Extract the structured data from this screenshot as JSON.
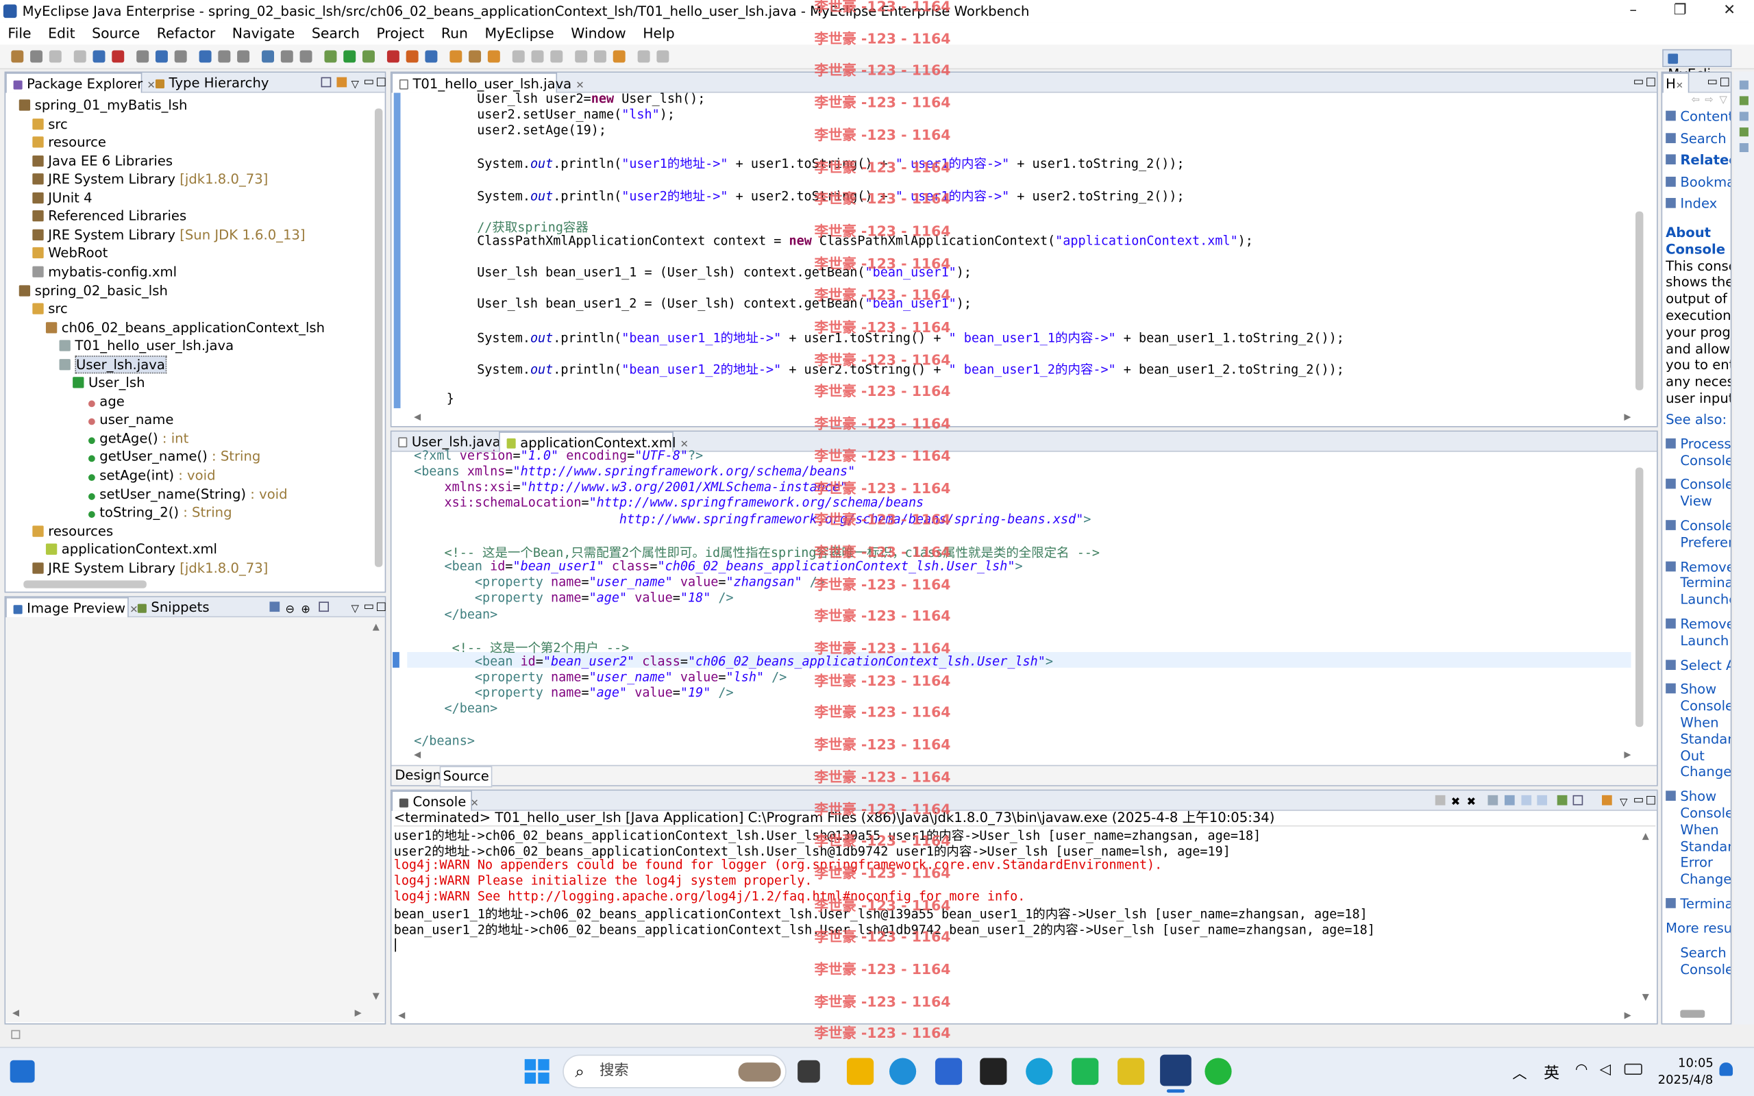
{
  "window": {
    "title": "MyEclipse Java Enterprise - spring_02_basic_lsh/src/ch06_02_beans_applicationContext_lsh/T01_hello_user_lsh.java - MyEclipse Enterprise Workbench",
    "minimize": "–",
    "maximize": "❐",
    "close": "✕"
  },
  "menu": [
    "File",
    "Edit",
    "Source",
    "Refactor",
    "Navigate",
    "Search",
    "Project",
    "Run",
    "MyEclipse",
    "Window",
    "Help"
  ],
  "perspective": "MyEcli...",
  "package_explorer": {
    "tab1": "Package Explorer",
    "tab2": "Type Hierarchy",
    "items": [
      {
        "text": "spring_01_myBatis_lsh",
        "extra": "",
        "indent": 0,
        "icon": "project"
      },
      {
        "text": "src",
        "extra": "",
        "indent": 1,
        "icon": "folder"
      },
      {
        "text": "resource",
        "extra": "",
        "indent": 1,
        "icon": "folder"
      },
      {
        "text": "Java EE 6 Libraries",
        "extra": "",
        "indent": 1,
        "icon": "lib"
      },
      {
        "text": "JRE System Library",
        "extra": " [jdk1.8.0_73]",
        "indent": 1,
        "icon": "lib"
      },
      {
        "text": "JUnit 4",
        "extra": "",
        "indent": 1,
        "icon": "lib"
      },
      {
        "text": "Referenced Libraries",
        "extra": "",
        "indent": 1,
        "icon": "lib"
      },
      {
        "text": "JRE System Library",
        "extra": " [Sun JDK 1.6.0_13]",
        "indent": 1,
        "icon": "lib"
      },
      {
        "text": "WebRoot",
        "extra": "",
        "indent": 1,
        "icon": "folder"
      },
      {
        "text": "mybatis-config.xml",
        "extra": "",
        "indent": 1,
        "icon": "file"
      },
      {
        "text": "spring_02_basic_lsh",
        "extra": "",
        "indent": 0,
        "icon": "project"
      },
      {
        "text": "src",
        "extra": "",
        "indent": 1,
        "icon": "folder"
      },
      {
        "text": "ch06_02_beans_applicationContext_lsh",
        "extra": "",
        "indent": 2,
        "icon": "package"
      },
      {
        "text": "T01_hello_user_lsh.java",
        "extra": "",
        "indent": 3,
        "icon": "java"
      },
      {
        "text": "User_lsh.java",
        "extra": "",
        "indent": 3,
        "icon": "java"
      },
      {
        "text": "User_lsh",
        "extra": "",
        "indent": 4,
        "icon": "class"
      },
      {
        "text": "age",
        "extra": "",
        "indent": 5,
        "icon": "field"
      },
      {
        "text": "user_name",
        "extra": "",
        "indent": 5,
        "icon": "field"
      },
      {
        "text": "getAge()",
        "extra": " : int",
        "indent": 5,
        "icon": "method"
      },
      {
        "text": "getUser_name()",
        "extra": " : String",
        "indent": 5,
        "icon": "method"
      },
      {
        "text": "setAge(int)",
        "extra": " : void",
        "indent": 5,
        "icon": "method"
      },
      {
        "text": "setUser_name(String)",
        "extra": " : void",
        "indent": 5,
        "icon": "method"
      },
      {
        "text": "toString_2()",
        "extra": " : String",
        "indent": 5,
        "icon": "method"
      },
      {
        "text": "resources",
        "extra": "",
        "indent": 1,
        "icon": "folder"
      },
      {
        "text": "applicationContext.xml",
        "extra": "",
        "indent": 2,
        "icon": "xml"
      },
      {
        "text": "JRE System Library",
        "extra": " [jdk1.8.0_73]",
        "indent": 1,
        "icon": "lib"
      }
    ],
    "selected_index": 14
  },
  "image_preview": {
    "tab1": "Image Preview",
    "tab2": "Snippets"
  },
  "editor1": {
    "tab": "T01_hello_user_lsh.java",
    "lines": [
      [
        [
          "",
          "        User_lsh user2="
        ],
        [
          "kw",
          "new"
        ],
        [
          "",
          " User_lsh();"
        ]
      ],
      [
        [
          "",
          "        user2.setUser_name("
        ],
        [
          "st",
          "\"lsh\""
        ],
        [
          "",
          ");"
        ]
      ],
      [
        [
          "",
          "        user2.setAge(19);"
        ]
      ],
      [],
      [
        [
          "",
          "        System."
        ],
        [
          "it",
          "out"
        ],
        [
          "",
          ".println("
        ],
        [
          "st",
          "\"user1的地址->\""
        ],
        [
          "",
          " + user1.toString() + "
        ],
        [
          "st",
          "\" user1的内容->\""
        ],
        [
          "",
          " + user1.toString_2());"
        ]
      ],
      [],
      [
        [
          "",
          "        System."
        ],
        [
          "it",
          "out"
        ],
        [
          "",
          ".println("
        ],
        [
          "st",
          "\"user2的地址->\""
        ],
        [
          "",
          " + user2.toString() + "
        ],
        [
          "st",
          "\" user1的内容->\""
        ],
        [
          "",
          " + user2.toString_2());"
        ]
      ],
      [],
      [
        [
          "cm",
          "        //获取spring容器"
        ]
      ],
      [
        [
          "",
          "        ClassPathXmlApplicationContext context = "
        ],
        [
          "kw",
          "new"
        ],
        [
          "",
          " ClassPathXmlApplicationContext("
        ],
        [
          "st",
          "\"applicationContext.xml\""
        ],
        [
          "",
          ");"
        ]
      ],
      [],
      [
        [
          "",
          "        User_lsh bean_user1_1 = (User_lsh) context.getBean("
        ],
        [
          "st",
          "\"bean_user1\""
        ],
        [
          "",
          ");"
        ]
      ],
      [],
      [
        [
          "",
          "        User_lsh bean_user1_2 = (User_lsh) context.getBean("
        ],
        [
          "st",
          "\"bean_user1\""
        ],
        [
          "",
          ");"
        ]
      ],
      [],
      [
        [
          "",
          "        System."
        ],
        [
          "it",
          "out"
        ],
        [
          "",
          ".println("
        ],
        [
          "st",
          "\"bean_user1_1的地址->\""
        ],
        [
          "",
          " + user1.toString() + "
        ],
        [
          "st",
          "\" bean_user1_1的内容->\""
        ],
        [
          "",
          " + bean_user1_1.toString_2());"
        ]
      ],
      [],
      [
        [
          "",
          "        System."
        ],
        [
          "it",
          "out"
        ],
        [
          "",
          ".println("
        ],
        [
          "st",
          "\"bean_user1_2的地址->\""
        ],
        [
          "",
          " + user2.toString() + "
        ],
        [
          "st",
          "\" bean_user1_2的内容->\""
        ],
        [
          "",
          " + bean_user1_2.toString_2());"
        ]
      ],
      [],
      [
        [
          "",
          "    }"
        ]
      ]
    ]
  },
  "editor2": {
    "tab1": "User_lsh.java",
    "tab2": "applicationContext.xml",
    "design": "Design",
    "source": "Source",
    "lines": [
      [
        [
          "xt",
          "<?xml "
        ],
        [
          "xa",
          "version"
        ],
        [
          "",
          "="
        ],
        [
          "xv",
          "\"1.0\""
        ],
        [
          "",
          " "
        ],
        [
          "xa",
          "encoding"
        ],
        [
          "",
          "="
        ],
        [
          "xv",
          "\"UTF-8\""
        ],
        [
          "xt",
          "?>"
        ]
      ],
      [
        [
          "xt",
          "<beans "
        ],
        [
          "xa",
          "xmlns"
        ],
        [
          "",
          "="
        ],
        [
          "xv",
          "\"http://www.springframework.org/schema/beans\""
        ]
      ],
      [
        [
          "",
          "    "
        ],
        [
          "xa",
          "xmlns:xsi"
        ],
        [
          "",
          "="
        ],
        [
          "xv",
          "\"http://www.w3.org/2001/XMLSchema-instance\""
        ]
      ],
      [
        [
          "",
          "    "
        ],
        [
          "xa",
          "xsi:schemaLocation"
        ],
        [
          "",
          "="
        ],
        [
          "xv",
          "\"http://www.springframework.org/schema/beans"
        ]
      ],
      [
        [
          "xv",
          "                           http://www.springframework.org/schema/beans/spring-beans.xsd\""
        ],
        [
          "xt",
          ">"
        ]
      ],
      [],
      [
        [
          "cm",
          "    <!-- 这是一个Bean,只需配置2个属性即可。id属性指在spring容器唯一标识，class属性就是类的全限定名 -->"
        ]
      ],
      [
        [
          "xt",
          "    <bean "
        ],
        [
          "xa",
          "id"
        ],
        [
          "",
          "="
        ],
        [
          "xv",
          "\"bean_user1\""
        ],
        [
          "",
          " "
        ],
        [
          "xa",
          "class"
        ],
        [
          "",
          "="
        ],
        [
          "xv",
          "\"ch06_02_beans_applicationContext_lsh.User_lsh\""
        ],
        [
          "xt",
          ">"
        ]
      ],
      [
        [
          "xt",
          "        <property "
        ],
        [
          "xa",
          "name"
        ],
        [
          "",
          "="
        ],
        [
          "xv",
          "\"user_name\""
        ],
        [
          "",
          " "
        ],
        [
          "xa",
          "value"
        ],
        [
          "",
          "="
        ],
        [
          "xv",
          "\"zhangsan\""
        ],
        [
          "xt",
          " />"
        ]
      ],
      [
        [
          "xt",
          "        <property "
        ],
        [
          "xa",
          "name"
        ],
        [
          "",
          "="
        ],
        [
          "xv",
          "\"age\""
        ],
        [
          "",
          " "
        ],
        [
          "xa",
          "value"
        ],
        [
          "",
          "="
        ],
        [
          "xv",
          "\"18\""
        ],
        [
          "xt",
          " />"
        ]
      ],
      [
        [
          "xt",
          "    </bean>"
        ]
      ],
      [],
      [
        [
          "cm",
          "     <!-- 这是一个第2个用户 -->"
        ]
      ],
      [
        [
          "xt",
          "        <bean "
        ],
        [
          "xa",
          "id"
        ],
        [
          "",
          "="
        ],
        [
          "xv",
          "\"bean_user2\""
        ],
        [
          "",
          " "
        ],
        [
          "xa",
          "class"
        ],
        [
          "",
          "="
        ],
        [
          "xv",
          "\"ch06_02_beans_applicationContext_lsh.User_lsh\""
        ],
        [
          "xt",
          ">"
        ]
      ],
      [
        [
          "xt",
          "        <property "
        ],
        [
          "xa",
          "name"
        ],
        [
          "",
          "="
        ],
        [
          "xv",
          "\"user_name\""
        ],
        [
          "",
          " "
        ],
        [
          "xa",
          "value"
        ],
        [
          "",
          "="
        ],
        [
          "xv",
          "\"lsh\""
        ],
        [
          "xt",
          " />"
        ]
      ],
      [
        [
          "xt",
          "        <property "
        ],
        [
          "xa",
          "name"
        ],
        [
          "",
          "="
        ],
        [
          "xv",
          "\"age\""
        ],
        [
          "",
          " "
        ],
        [
          "xa",
          "value"
        ],
        [
          "",
          "="
        ],
        [
          "xv",
          "\"19\""
        ],
        [
          "xt",
          " />"
        ]
      ],
      [
        [
          "xt",
          "    </bean>"
        ]
      ],
      [],
      [
        [
          "xt",
          "</beans>"
        ]
      ]
    ]
  },
  "console": {
    "tab": "Console",
    "status": "<terminated> T01_hello_user_lsh [Java Application] C:\\Program Files (x86)\\Java\\jdk1.8.0_73\\bin\\javaw.exe (2025-4-8 上午10:05:34)",
    "lines": [
      {
        "text": "user1的地址->ch06_02_beans_applicationContext_lsh.User_lsh@139a55 user1的内容->User_lsh [user_name=zhangsan, age=18]",
        "err": false
      },
      {
        "text": "user2的地址->ch06_02_beans_applicationContext_lsh.User_lsh@1db9742 user1的内容->User_lsh [user_name=lsh, age=19]",
        "err": false
      },
      {
        "text": "log4j:WARN No appenders could be found for logger (org.springframework.core.env.StandardEnvironment).",
        "err": true
      },
      {
        "text": "log4j:WARN Please initialize the log4j system properly.",
        "err": true
      },
      {
        "text": "log4j:WARN See http://logging.apache.org/log4j/1.2/faq.html#noconfig for more info.",
        "err": true
      },
      {
        "text": "bean_user1_1的地址->ch06_02_beans_applicationContext_lsh.User_lsh@139a55 bean_user1_1的内容->User_lsh [user_name=zhangsan, age=18]",
        "err": false
      },
      {
        "text": "bean_user1_2的地址->ch06_02_beans_applicationContext_lsh.User_lsh@1db9742 bean_user1_2的内容->User_lsh [user_name=zhangsan, age=18]",
        "err": false
      }
    ]
  },
  "help": {
    "tab": "H",
    "items": [
      "Content",
      "Search",
      "Relatec",
      "Bookma",
      "Index"
    ],
    "about_title": [
      "About",
      "Console"
    ],
    "about_text": [
      "This consol",
      "shows the",
      "output of t",
      "execution c",
      "your progr",
      "and allows",
      "you to ente",
      "any necess",
      "user input."
    ],
    "see_also": "See also:",
    "links": [
      [
        "Process",
        "Console"
      ],
      [
        "Console",
        "View"
      ],
      [
        "Console",
        "Preferen"
      ],
      [
        "Remove",
        "Termina",
        "Launche"
      ],
      [
        "Remove",
        "Launch"
      ],
      [
        "Select Al"
      ],
      [
        "Show",
        "Console",
        "When",
        "Standard",
        "Out",
        "Changes"
      ],
      [
        "Show",
        "Console",
        "When",
        "Standard",
        "Error",
        "Changes"
      ],
      [
        "Termina"
      ]
    ],
    "more": "More resul",
    "search_console": [
      "Search fo",
      "Console vie"
    ]
  },
  "watermark": "李世豪 -123 - 1164",
  "taskbar": {
    "search_placeholder": "搜索",
    "ime": "英",
    "time": "10:05",
    "date": "2025/4/8"
  }
}
